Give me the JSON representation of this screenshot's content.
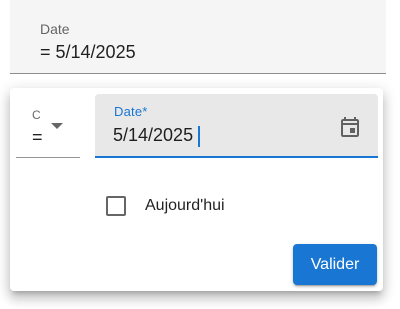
{
  "filter": {
    "label": "Date",
    "value": "= 5/14/2025"
  },
  "popover": {
    "operator": {
      "label": "C",
      "value": "=",
      "arrow_icon": "arrow-drop-down-icon"
    },
    "date_field": {
      "label": "Date*",
      "value": "5/14/2025",
      "icon": "calendar-icon"
    },
    "today_checkbox": {
      "label": "Aujourd'hui",
      "checked": false
    },
    "submit": {
      "label": "Valider"
    }
  },
  "colors": {
    "accent": "#1976d2",
    "field_bg": "#f5f5f5",
    "active_field_bg": "#e8e8e8",
    "icon": "#616161"
  }
}
